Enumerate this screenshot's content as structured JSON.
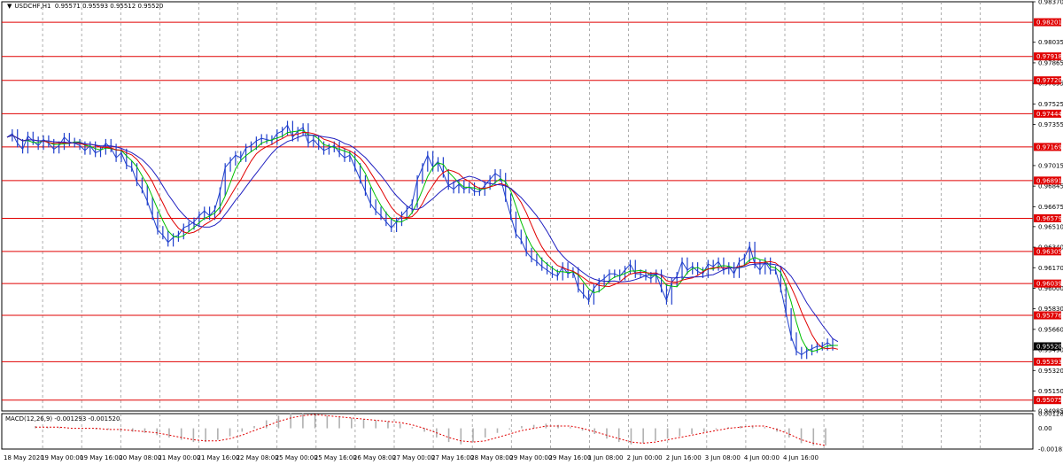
{
  "header": {
    "symbol": "USDCHF,H1",
    "ohlc": "0.95571 0.95593 0.95512 0.95520"
  },
  "macd_label": "MACD(12,26,9) -0.001293 -0.001520",
  "colors": {
    "price": "#1f3fcc",
    "ma_fast": "#00c000",
    "ma_mid": "#e00000",
    "ma_slow": "#2020c0",
    "level": "#e00000",
    "grid": "#9a9a9a",
    "macd_hist": "#b0b0b0",
    "macd_signal": "#e00000"
  },
  "chart_data": [
    {
      "type": "line",
      "title": "USDCHF,H1",
      "x_ticks": [
        "18 May 2020",
        "19 May 00:00",
        "19 May 16:00",
        "20 May 08:00",
        "21 May 00:00",
        "21 May 16:00",
        "22 May 08:00",
        "25 May 00:00",
        "25 May 16:00",
        "26 May 08:00",
        "27 May 00:00",
        "27 May 16:00",
        "28 May 08:00",
        "29 May 00:00",
        "29 May 16:00",
        "1 Jun 08:00",
        "2 Jun 00:00",
        "2 Jun 16:00",
        "3 Jun 08:00",
        "4 Jun 00:00",
        "4 Jun 16:00"
      ],
      "y_ticks": [
        "0.98370",
        "0.98035",
        "0.97865",
        "0.97695",
        "0.97525",
        "0.97355",
        "0.97015",
        "0.96845",
        "0.96675",
        "0.96510",
        "0.96340",
        "0.96170",
        "0.96000",
        "0.95830",
        "0.95660",
        "0.95490",
        "0.95320",
        "0.95150",
        "0.94985"
      ],
      "ylim": [
        0.94985,
        0.9837
      ],
      "levels": [
        {
          "label": "0.98201",
          "value": 0.98201
        },
        {
          "label": "0.97918",
          "value": 0.97918
        },
        {
          "label": "0.97720",
          "value": 0.9772
        },
        {
          "label": "0.97444",
          "value": 0.97444
        },
        {
          "label": "0.97169",
          "value": 0.97169
        },
        {
          "label": "0.96891",
          "value": 0.96891
        },
        {
          "label": "0.96579",
          "value": 0.96579
        },
        {
          "label": "0.96305",
          "value": 0.96305
        },
        {
          "label": "0.96039",
          "value": 0.96039
        },
        {
          "label": "0.95776",
          "value": 0.95776
        },
        {
          "label": "0.95393",
          "value": 0.95393
        },
        {
          "label": "0.95075",
          "value": 0.95075
        }
      ],
      "current_price": {
        "label": "0.95520",
        "value": 0.9552
      },
      "series": [
        {
          "values": [
            0.9725,
            0.9728,
            0.972,
            0.9715,
            0.9726,
            0.9722,
            0.9718,
            0.9723,
            0.972,
            0.9715,
            0.9718,
            0.9725,
            0.9721,
            0.972,
            0.9718,
            0.9714,
            0.9718,
            0.9712,
            0.9714,
            0.972,
            0.9716,
            0.9708,
            0.9712,
            0.9702,
            0.97,
            0.9688,
            0.9682,
            0.9672,
            0.966,
            0.9648,
            0.9644,
            0.9638,
            0.9642,
            0.9644,
            0.965,
            0.9652,
            0.9655,
            0.966,
            0.9664,
            0.966,
            0.9665,
            0.968,
            0.97,
            0.9705,
            0.971,
            0.9708,
            0.9716,
            0.9718,
            0.9722,
            0.9724,
            0.9723,
            0.9722,
            0.9728,
            0.973,
            0.9735,
            0.9725,
            0.973,
            0.9733,
            0.972,
            0.9723,
            0.9718,
            0.9714,
            0.9716,
            0.9718,
            0.9712,
            0.9708,
            0.971,
            0.97,
            0.969,
            0.968,
            0.967,
            0.9664,
            0.966,
            0.9655,
            0.965,
            0.9655,
            0.966,
            0.9665,
            0.967,
            0.969,
            0.97,
            0.971,
            0.97,
            0.9705,
            0.9695,
            0.9685,
            0.9682,
            0.9686,
            0.9682,
            0.9684,
            0.968,
            0.968,
            0.9685,
            0.969,
            0.9695,
            0.9692,
            0.9675,
            0.966,
            0.9645,
            0.964,
            0.963,
            0.9625,
            0.9622,
            0.9618,
            0.9615,
            0.9612,
            0.961,
            0.9618,
            0.9612,
            0.9614,
            0.96,
            0.9595,
            0.959,
            0.96,
            0.9605,
            0.9608,
            0.9612,
            0.9612,
            0.961,
            0.9615,
            0.962,
            0.9612,
            0.9612,
            0.961,
            0.9608,
            0.9612,
            0.96,
            0.959,
            0.9605,
            0.961,
            0.9622,
            0.9615,
            0.9618,
            0.9614,
            0.9612,
            0.962,
            0.9618,
            0.9622,
            0.9615,
            0.9618,
            0.9612,
            0.9622,
            0.9625,
            0.9635,
            0.962,
            0.9615,
            0.9622,
            0.9615,
            0.9615,
            0.96,
            0.958,
            0.956,
            0.9548,
            0.9545,
            0.9548,
            0.955,
            0.9552,
            0.9552,
            0.9555,
            0.9552
          ]
        }
      ]
    },
    {
      "type": "bar",
      "title": "MACD(12,26,9) -0.001293 -0.001520",
      "y_ticks": [
        "0.00128",
        "0.00",
        "-0.001812"
      ],
      "ylim": [
        -0.001812,
        0.00128
      ],
      "series": [
        {
          "values": [
            0.0002,
            0.0001,
            0.0001,
            0.0,
            0.0,
            -0.0001,
            -0.0001,
            -0.0002,
            -0.0003,
            -0.0004,
            -0.0006,
            -0.0008,
            -0.001,
            -0.0012,
            -0.0012,
            -0.001,
            -0.0007,
            -0.0003,
            0.0002,
            0.0007,
            0.0011,
            0.0013,
            0.0013,
            0.0012,
            0.0011,
            0.001,
            0.0009,
            0.0008,
            0.0007,
            0.0006,
            0.0004,
            0.0001,
            -0.0003,
            -0.0008,
            -0.0012,
            -0.0014,
            -0.0012,
            -0.0008,
            -0.0004,
            -0.0001,
            0.0002,
            0.0003,
            0.0004,
            0.0003,
            0.0001,
            -0.0002,
            -0.0005,
            -0.0009,
            -0.0012,
            -0.0014,
            -0.0013,
            -0.0011,
            -0.0009,
            -0.0007,
            -0.0005,
            -0.0003,
            -0.0001,
            0.0001,
            0.0002,
            0.0002,
            0.0001,
            -0.0003,
            -0.0008,
            -0.0013,
            -0.0015,
            -0.0015
          ]
        },
        {
          "values": [
            0.0001,
            0.0001,
            0.0001,
            0.0,
            0.0,
            0.0,
            -0.0001,
            -0.0001,
            -0.0002,
            -0.0003,
            -0.0004,
            -0.0006,
            -0.0008,
            -0.001,
            -0.0011,
            -0.0011,
            -0.0009,
            -0.0006,
            -0.0002,
            0.0002,
            0.0006,
            0.0009,
            0.0011,
            0.0012,
            0.0011,
            0.001,
            0.0009,
            0.0008,
            0.0007,
            0.0006,
            0.0005,
            0.0003,
            0.0,
            -0.0004,
            -0.0008,
            -0.0011,
            -0.0012,
            -0.0011,
            -0.0008,
            -0.0005,
            -0.0002,
            0.0,
            0.0002,
            0.0002,
            0.0002,
            0.0,
            -0.0003,
            -0.0006,
            -0.0009,
            -0.0012,
            -0.0013,
            -0.0012,
            -0.001,
            -0.0008,
            -0.0006,
            -0.0004,
            -0.0002,
            0.0,
            0.0001,
            0.0002,
            0.0002,
            -0.0001,
            -0.0005,
            -0.001,
            -0.0013,
            -0.0015
          ]
        }
      ]
    }
  ]
}
